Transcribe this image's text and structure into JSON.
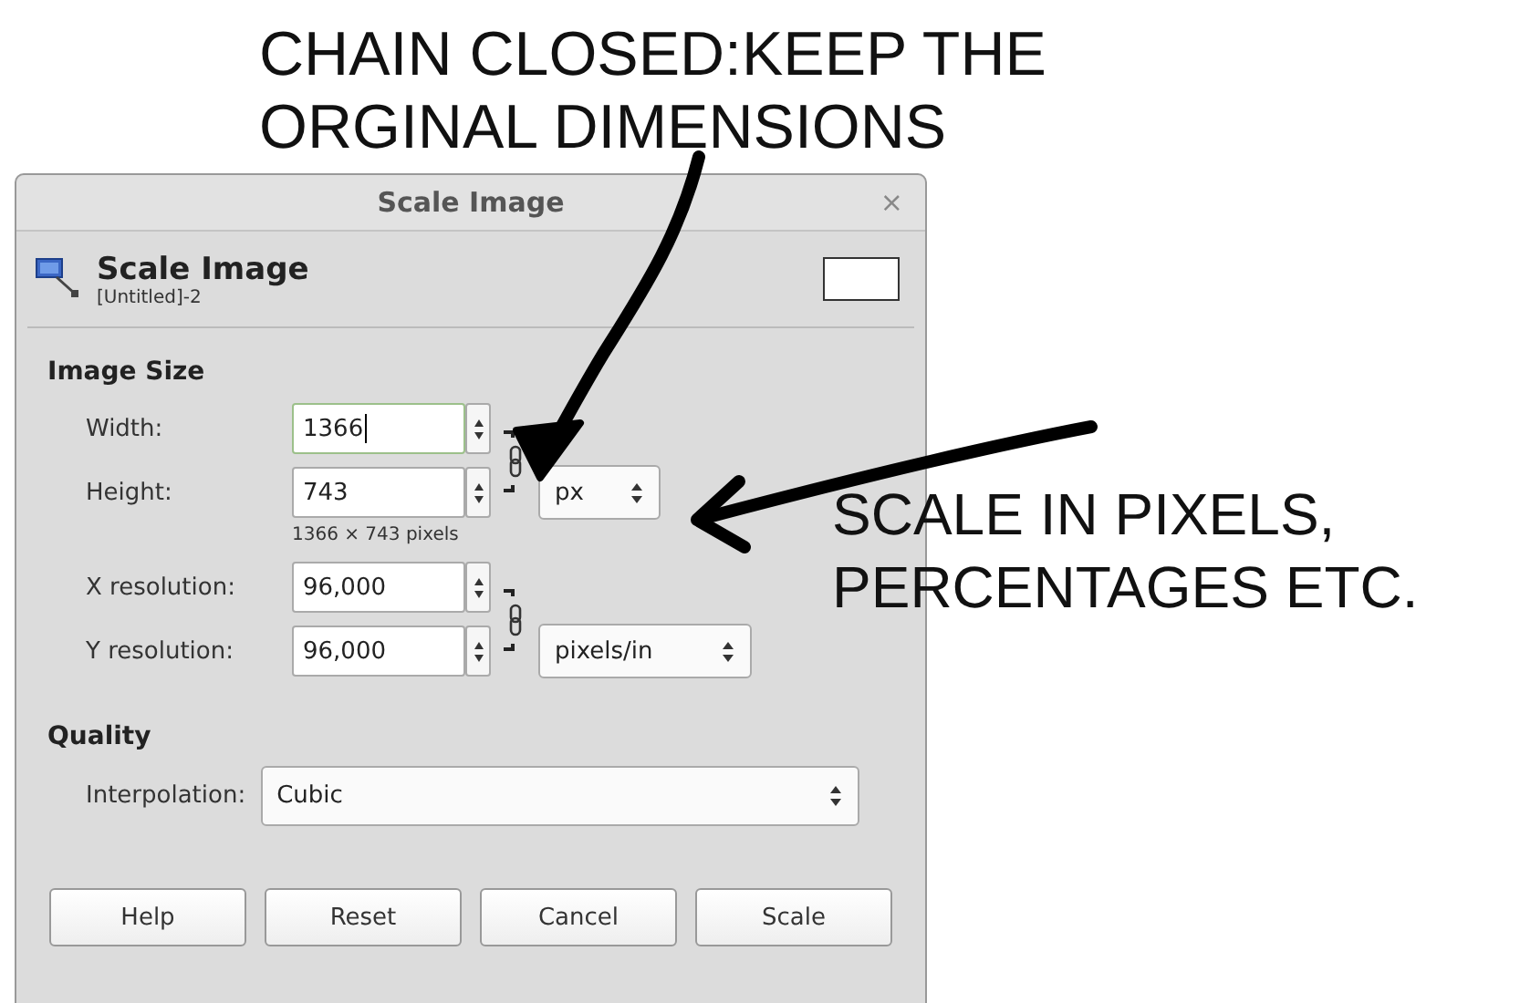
{
  "annotations": [
    {
      "lines": [
        "CHAIN CLOSED:KEEP THE",
        "ORGINAL DIMENSIONS"
      ]
    },
    {
      "lines": [
        "SCALE IN PIXELS,",
        "PERCENTAGES ETC."
      ]
    }
  ],
  "window": {
    "title": "Scale Image",
    "close": "×"
  },
  "header": {
    "title": "Scale Image",
    "subtitle": "[Untitled]-2"
  },
  "image_size": {
    "heading": "Image Size",
    "fields": [
      {
        "label": "Width:",
        "value": "1366",
        "focused": true
      },
      {
        "label": "Height:",
        "value": "743",
        "focused": false
      }
    ],
    "size_note": "1366 × 743 pixels",
    "size_chain_linked": true,
    "size_unit": "px",
    "resolution_fields": [
      {
        "label": "X resolution:",
        "value": "96,000",
        "focused": false
      },
      {
        "label": "Y resolution:",
        "value": "96,000",
        "focused": false
      }
    ],
    "resolution_chain_linked": true,
    "resolution_unit": "pixels/in"
  },
  "quality": {
    "heading": "Quality",
    "interpolation": {
      "label": "Interpolation:",
      "value": "Cubic"
    }
  },
  "buttons": [
    "Help",
    "Reset",
    "Cancel",
    "Scale"
  ]
}
